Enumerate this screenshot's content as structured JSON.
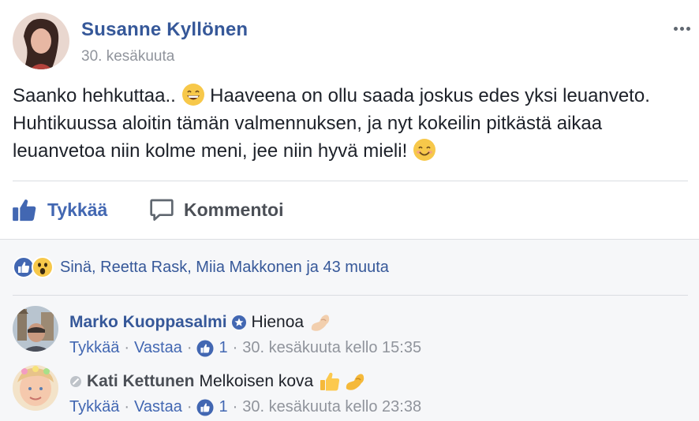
{
  "post": {
    "author": "Susanne Kyllönen",
    "date": "30. kesäkuuta",
    "text_part1": "Saanko hehkuttaa.. ",
    "text_part2": " Haaveena on ollu saada joskus edes yksi leuanveto. Huhtikuussa aloitin tämän valmennuksen, ja nyt kokeilin pitkästä aikaa leuanvetoa niin kolme meni, jee niin hyvä mieli! ",
    "emoji1": "grinning-face-icon",
    "emoji2": "smiling-face-icon"
  },
  "actions": {
    "like_label": "Tykkää",
    "comment_label": "Kommentoi"
  },
  "reactions": {
    "names": "Sinä, Reetta Rask, Miia Makkonen ja 43 muuta"
  },
  "comments": [
    {
      "name": "Marko Kuoppasalmi",
      "text": "Hienoa",
      "emoji": "flexed-biceps-icon",
      "like": "Tykkää",
      "reply": "Vastaa",
      "likes": "1",
      "time": "30. kesäkuuta kello 15:35"
    },
    {
      "name": "Kati Kettunen",
      "text": "Melkoisen kova",
      "emoji": "thumbs-up-biceps-icon",
      "like": "Tykkää",
      "reply": "Vastaa",
      "likes": "1",
      "time": "30. kesäkuuta kello 23:38"
    }
  ],
  "separator": "·",
  "colors": {
    "link": "#365899",
    "action_active": "#4267b2",
    "meta": "#90949c",
    "background_social": "#f6f7f9"
  }
}
